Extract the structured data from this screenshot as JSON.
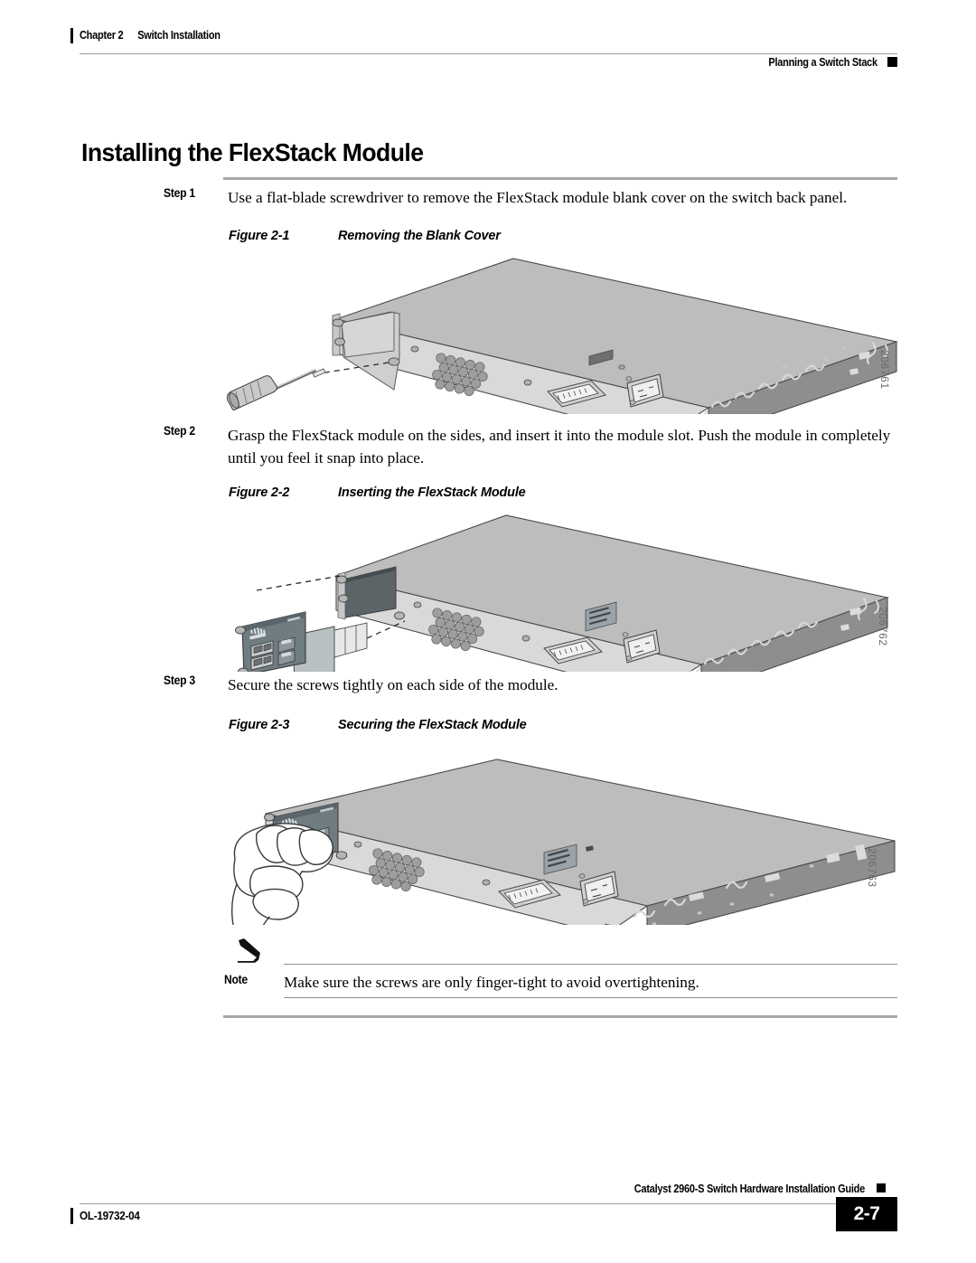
{
  "header": {
    "chapter": "Chapter 2",
    "chapter_title": "Switch Installation",
    "running_head": "Planning a Switch Stack"
  },
  "title": "Installing the FlexStack Module",
  "steps": [
    {
      "label": "Step 1",
      "text": "Use a flat-blade screwdriver to remove the FlexStack module blank cover on the switch back panel."
    },
    {
      "label": "Step 2",
      "text": "Grasp the FlexStack module on the sides, and insert it into the module slot. Push the module in completely until you feel it snap into place."
    },
    {
      "label": "Step 3",
      "text": "Secure the screws tightly on each side of the module."
    }
  ],
  "figures": [
    {
      "number": "Figure 2-1",
      "caption": "Removing the Blank Cover",
      "id": "206761"
    },
    {
      "number": "Figure 2-2",
      "caption": "Inserting the FlexStack Module",
      "id": "206762"
    },
    {
      "number": "Figure 2-3",
      "caption": "Securing the FlexStack Module",
      "id": "206763"
    }
  ],
  "note": {
    "label": "Note",
    "text": "Make sure the screws are only finger-tight to avoid overtightening."
  },
  "footer": {
    "guide": "Catalyst 2960-S Switch Hardware Installation Guide",
    "doc_number": "OL-19732-04",
    "page_number": "2-7"
  },
  "colors": {
    "rule_gray": "#a8a8a8",
    "chassis_top": "#bdbdbd",
    "chassis_face": "#d6d6d6",
    "chassis_side": "#8c8c8c",
    "module_face": "#6e7b80"
  }
}
